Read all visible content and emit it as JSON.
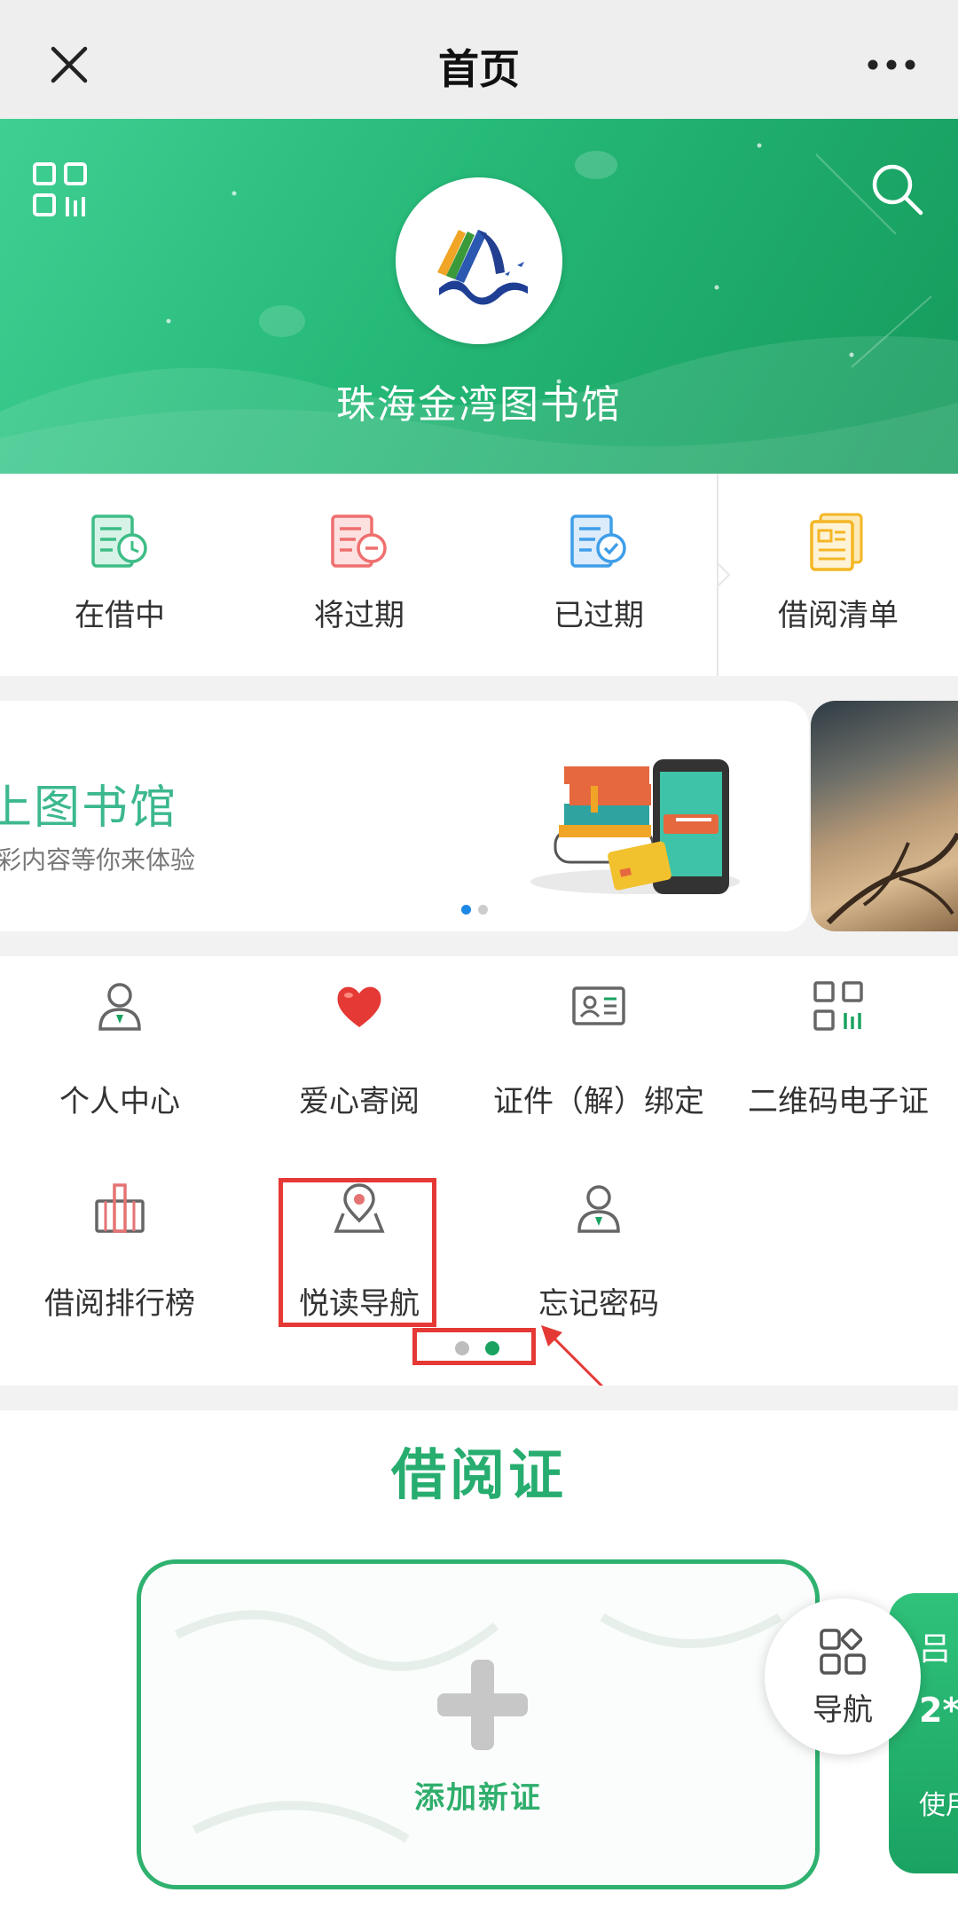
{
  "titlebar": {
    "title": "首页"
  },
  "hero": {
    "library_name": "珠海金湾图书馆"
  },
  "status": [
    {
      "label": "在借中",
      "color": "#3dbd86"
    },
    {
      "label": "将过期",
      "color": "#ef6f6f"
    },
    {
      "label": "已过期",
      "color": "#3f9ee8"
    },
    {
      "label": "借阅清单",
      "color": "#f4b624"
    }
  ],
  "banner": {
    "title": "上图书馆",
    "subtitle": "彩内容等你来体验",
    "slide_count": 2,
    "active_slide": 1
  },
  "functions": [
    {
      "label": "个人中心",
      "icon": "user-icon"
    },
    {
      "label": "爱心寄阅",
      "icon": "heart-icon"
    },
    {
      "label": "证件（解）绑定",
      "icon": "id-card-icon"
    },
    {
      "label": "二维码电子证",
      "icon": "qr-code-icon"
    },
    {
      "label": "借阅排行榜",
      "icon": "ranking-icon"
    },
    {
      "label": "悦读导航",
      "icon": "map-pin-icon"
    },
    {
      "label": "忘记密码",
      "icon": "user-key-icon"
    }
  ],
  "function_pager": {
    "page_count": 2,
    "active_page": 2
  },
  "card_section": {
    "title": "借阅证",
    "add_label": "添加新证",
    "peek_card": {
      "line1": "吕",
      "line2": "2*",
      "line3": "使用"
    },
    "nav_button_label": "导航"
  },
  "colors": {
    "brand_green": "#1aa260",
    "annotation_red": "#e53935"
  }
}
